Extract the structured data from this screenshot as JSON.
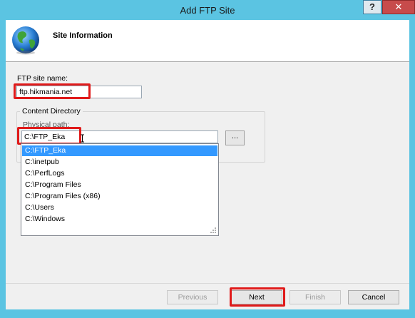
{
  "window": {
    "title": "Add FTP Site",
    "help_label": "?",
    "close_label": "✕"
  },
  "header": {
    "title": "Site Information",
    "icon": "globe-icon"
  },
  "form": {
    "site_name_label": "FTP site name:",
    "site_name_value": "ftp.hikmania.net",
    "content_directory_label": "Content Directory",
    "physical_path_label": "Physical path:",
    "physical_path_value": "C:\\FTP_Eka",
    "browse_label": "..."
  },
  "autocomplete": {
    "items": [
      "C:\\FTP_Eka",
      "C:\\inetpub",
      "C:\\PerfLogs",
      "C:\\Program Files",
      "C:\\Program Files (x86)",
      "C:\\Users",
      "C:\\Windows"
    ],
    "selected_index": 0
  },
  "buttons": {
    "previous": "Previous",
    "next": "Next",
    "finish": "Finish",
    "cancel": "Cancel"
  },
  "colors": {
    "title_bar": "#5bc4e2",
    "highlight": "#e01a1a",
    "selection": "#3399ff"
  }
}
